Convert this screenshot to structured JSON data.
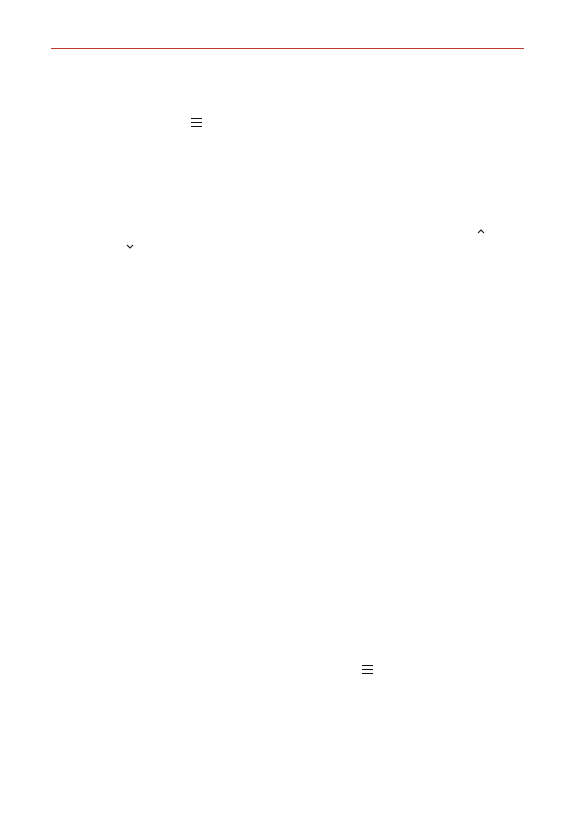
{
  "page": {
    "rule_color": "#c0392b"
  },
  "icons": {
    "menu_icon_top": "menu-icon",
    "chevron_up": "chevron-up-icon",
    "chevron_down": "chevron-down-icon",
    "menu_icon_bottom": "menu-icon"
  }
}
